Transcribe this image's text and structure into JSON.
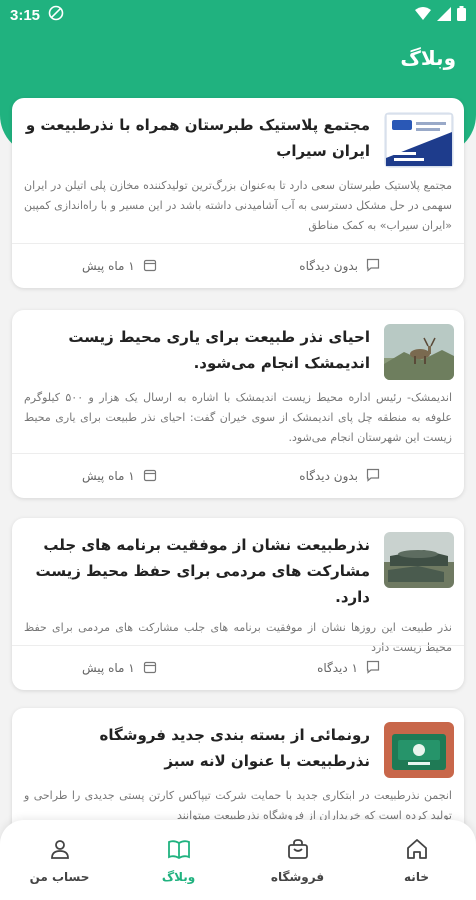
{
  "status_bar": {
    "time": "3:15"
  },
  "header": {
    "title": "وبلاگ"
  },
  "posts": [
    {
      "title": "مجتمع پلاستیک طبرستان همراه با نذرطبیعت و ایران سیراب",
      "excerpt": "مجتمع پلاستیک طبرستان سعی دارد تا به‌عنوان بزرگ‌ترین تولیدکننده مخازن پلی اتیلن در ایران سهمی در حل مشکل دسترسی به آب آشامیدنی داشته باشد در این مسیر و با راه‌اندازی کمپین «ایران سیراب» به کمک مناطق",
      "views": "بدون دیدگاه",
      "date": "۱ ماه پیش",
      "thumb": "sign"
    },
    {
      "title": "احیای نذر طبیعت برای یاری محیط زیست اندیمشک انجام می‌شود.",
      "excerpt": "اندیمشک- رئیس اداره محیط زیست اندیمشک با اشاره به ارسال یک هزار و ۵۰۰ کیلوگرم علوفه به منطقه چل پای اندیمشک از سوی خیران گفت: احیای نذر طبیعت برای یاری محیط زیست این شهرستان انجام می‌شود.",
      "views": "بدون دیدگاه",
      "date": "۱ ماه پیش",
      "thumb": "animal"
    },
    {
      "title": "نذرطبیعت نشان از موفقیت برنامه های جلب مشارکت های مردمی برای حفظ محیط زیست دارد.",
      "excerpt": "نذر طبیعت این روزها نشان از موفقیت برنامه های جلب مشارکت های مردمی برای حفظ محیط زیست دارد",
      "views": "۱ دیدگاه",
      "date": "۱ ماه پیش",
      "thumb": "tanks"
    },
    {
      "title": "رونمائی از بسته بندی جدید فروشگاه نذرطبیعت با عنوان لانه سبز",
      "excerpt": "انجمن نذرطبیعت در ابتکاری جدید با حمایت شرکت تیپاکس کارتن پستی جدیدی را طراحی و تولید کرده است که خریداران از فروشگاه نذرطبیعت میتوانند",
      "views": "",
      "date": "",
      "thumb": "box"
    }
  ],
  "bottom_nav": {
    "home": "خانه",
    "shop": "فروشگاه",
    "blog": "وبلاگ",
    "account": "حساب من"
  },
  "colors": {
    "accent": "#20b27f",
    "background": "#f3f3f3"
  }
}
